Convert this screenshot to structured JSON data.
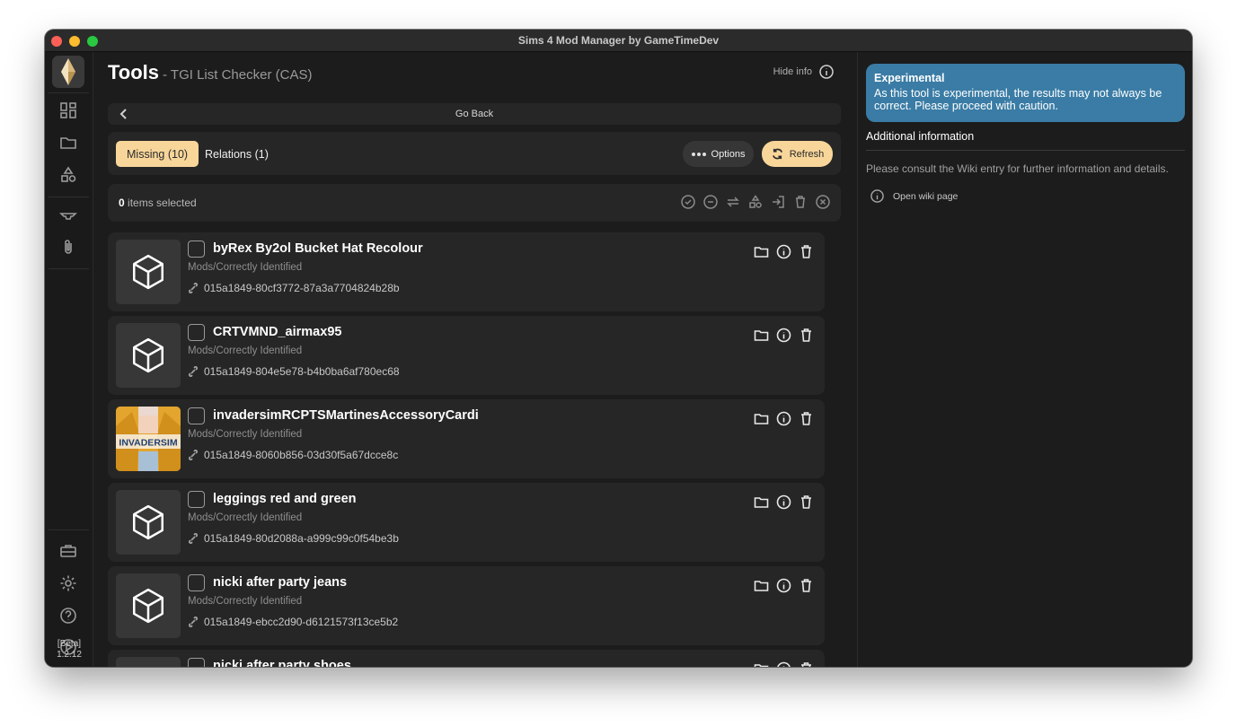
{
  "window": {
    "title": "Sims 4 Mod Manager by GameTimeDev"
  },
  "sidebar": {
    "icons": [
      "dashboard-icon",
      "folder-icon",
      "shapes-icon",
      "hanger-icon",
      "paperclip-icon",
      "toolbox-icon",
      "gear-icon",
      "help-icon",
      "play-icon"
    ],
    "version_tag": "[Beta]",
    "version_number": "1.2.12"
  },
  "header": {
    "title": "Tools",
    "subtitle": "- TGI List Checker (CAS)",
    "hide_info_label": "Hide info"
  },
  "goback": {
    "label": "Go Back"
  },
  "tabs": [
    {
      "label": "Missing (10)",
      "active": true
    },
    {
      "label": "Relations (1)",
      "active": false
    }
  ],
  "toolbar": {
    "options_label": "Options",
    "refresh_label": "Refresh"
  },
  "selection": {
    "count": "0",
    "label": "items selected"
  },
  "items": [
    {
      "title": "byRex By2ol Bucket Hat Recolour",
      "path": "Mods/Correctly Identified",
      "tgi": "015a1849-80cf3772-87a3a7704824b28b",
      "thumb": "cube"
    },
    {
      "title": "CRTVMND_airmax95",
      "path": "Mods/Correctly Identified",
      "tgi": "015a1849-804e5e78-b4b0ba6af780ec68",
      "thumb": "cube"
    },
    {
      "title": "invadersimRCPTSMartinesAccessoryCardi",
      "path": "Mods/Correctly Identified",
      "tgi": "015a1849-8060b856-03d30f5a67dcce8c",
      "thumb": "photo",
      "thumb_text": "INVADERSIM"
    },
    {
      "title": "leggings red and green",
      "path": "Mods/Correctly Identified",
      "tgi": "015a1849-80d2088a-a999c99c0f54be3b",
      "thumb": "cube"
    },
    {
      "title": "nicki after party jeans",
      "path": "Mods/Correctly Identified",
      "tgi": "015a1849-ebcc2d90-d6121573f13ce5b2",
      "thumb": "cube"
    },
    {
      "title": "nicki after party shoes",
      "path": "",
      "tgi": "",
      "thumb": "cube"
    }
  ],
  "panel": {
    "alert_title": "Experimental",
    "alert_body": "As this tool is experimental, the results may not always be correct. Please proceed with caution.",
    "section_title": "Additional information",
    "consult_text": "Please consult the Wiki entry for further information and details.",
    "wiki_link": "Open wiki page"
  },
  "colors": {
    "accent": "#f8d69a",
    "alert_bg": "#3a7ca5",
    "surface": "#262626",
    "background": "#1c1c1c"
  }
}
